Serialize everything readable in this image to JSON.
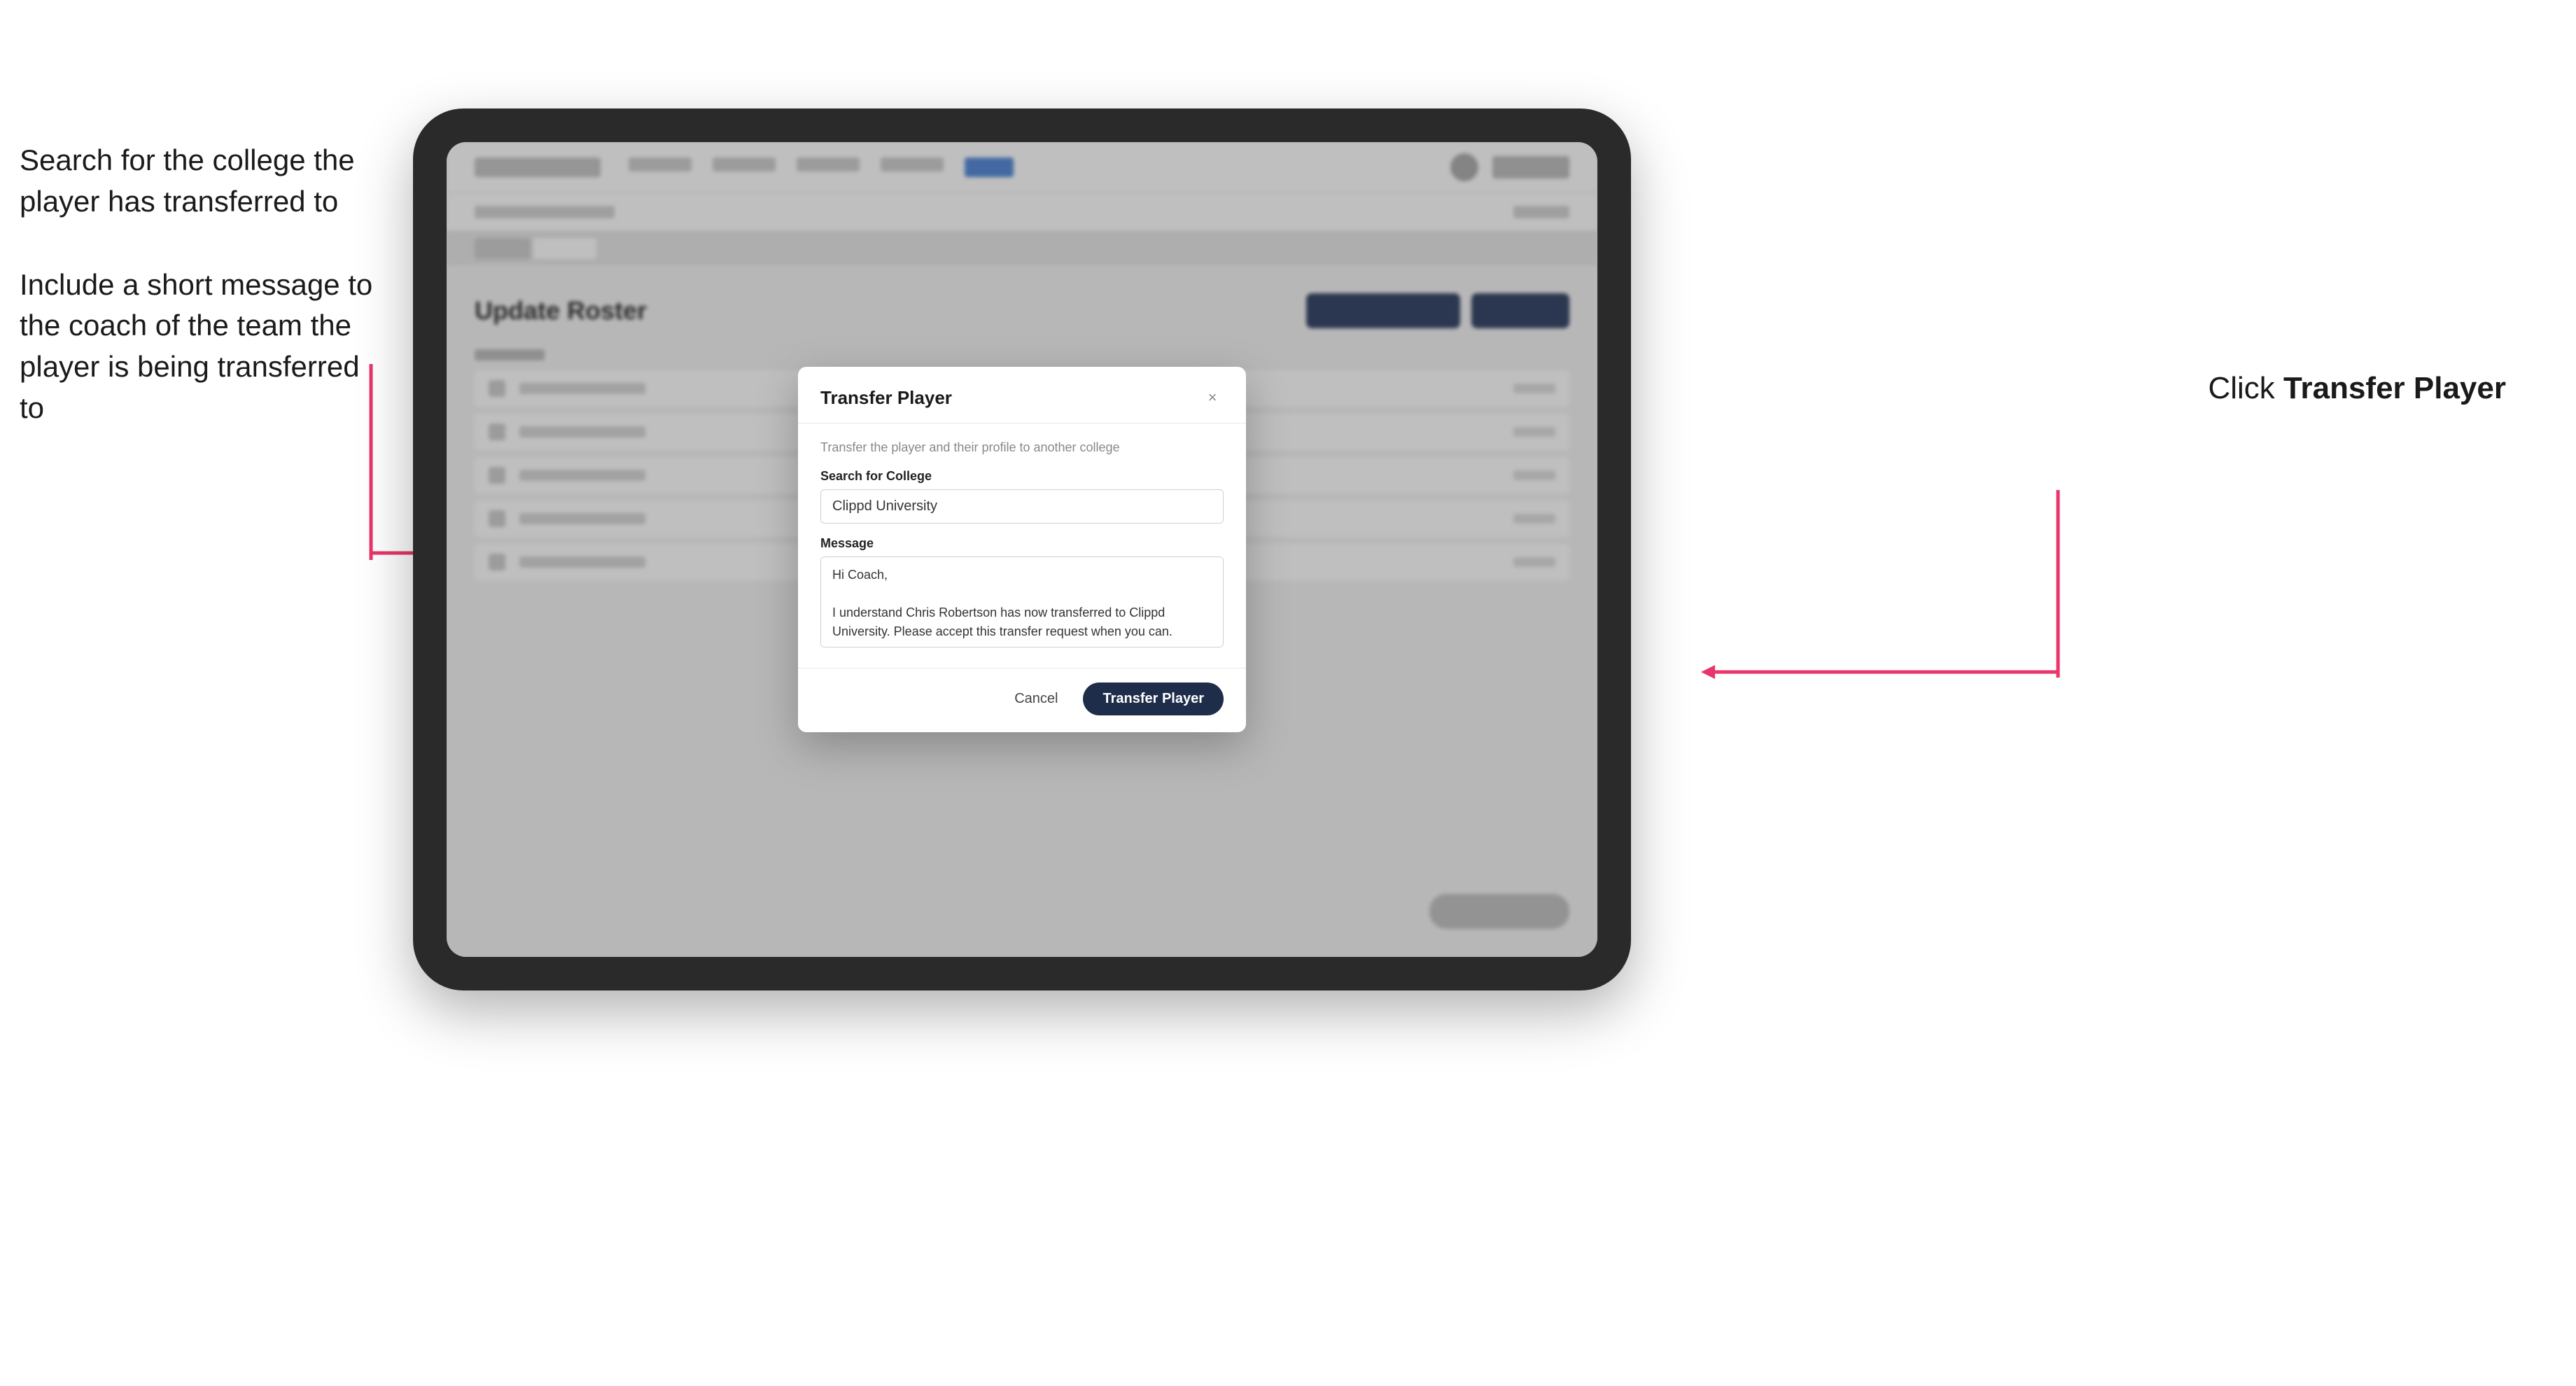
{
  "annotations": {
    "left_1": "Search for the college the player has transferred to",
    "left_2": "Include a short message to the coach of the team the player is being transferred to",
    "right": "Click ",
    "right_bold": "Transfer Player"
  },
  "tablet": {
    "app": {
      "page_title": "Update Roster"
    }
  },
  "modal": {
    "title": "Transfer Player",
    "subtitle": "Transfer the player and their profile to another college",
    "search_label": "Search for College",
    "search_value": "Clippd University",
    "message_label": "Message",
    "message_value": "Hi Coach,\n\nI understand Chris Robertson has now transferred to Clippd University. Please accept this transfer request when you can.",
    "cancel_label": "Cancel",
    "transfer_label": "Transfer Player",
    "close_icon": "×"
  }
}
